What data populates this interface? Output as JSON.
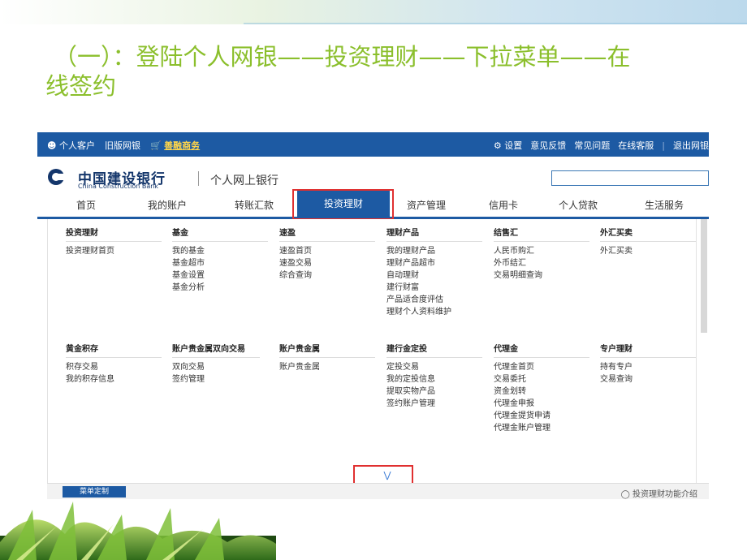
{
  "slide": {
    "title_line1": "（一）：登陆个人网银——投资理财——下拉菜单——在",
    "title_line2": "线签约"
  },
  "topbar": {
    "personal": "个人客户",
    "old_version": "旧版网银",
    "shanrong": "善融商务",
    "settings": "设置",
    "feedback": "意见反馈",
    "faq": "常见问题",
    "online_service": "在线客服",
    "logout": "退出网银"
  },
  "brand": {
    "name_cn": "中国建设银行",
    "name_en": "China Construction Bank",
    "product": "个人网上银行"
  },
  "search": {
    "placeholder": ""
  },
  "nav": {
    "items": [
      "首页",
      "我的账户",
      "转账汇款",
      "投资理财",
      "资产管理",
      "信用卡",
      "个人贷款",
      "生活服务"
    ],
    "active": "投资理财"
  },
  "menu": {
    "row1": [
      {
        "head": "投资理财",
        "links": [
          "投资理财首页"
        ]
      },
      {
        "head": "基金",
        "links": [
          "我的基金",
          "基金超市",
          "基金设置",
          "基金分析"
        ]
      },
      {
        "head": "速盈",
        "links": [
          "速盈首页",
          "速盈交易",
          "综合查询"
        ]
      },
      {
        "head": "理财产品",
        "links": [
          "我的理财产品",
          "理财产品超市",
          "自动理财",
          "建行财富",
          "产品适合度评估",
          "理财个人资料维护"
        ]
      },
      {
        "head": "结售汇",
        "links": [
          "人民币购汇",
          "外币结汇",
          "交易明细查询"
        ]
      },
      {
        "head": "外汇买卖",
        "links": [
          "外汇买卖"
        ]
      }
    ],
    "row2": [
      {
        "head": "黄金积存",
        "links": [
          "积存交易",
          "我的积存信息"
        ]
      },
      {
        "head": "账户贵金属双向交易",
        "links": [
          "双向交易",
          "签约管理"
        ]
      },
      {
        "head": "账户贵金属",
        "links": [
          "账户贵金属"
        ]
      },
      {
        "head": "建行金定投",
        "links": [
          "定投交易",
          "我的定投信息",
          "提取实物产品",
          "签约账户管理"
        ]
      },
      {
        "head": "代理金",
        "links": [
          "代理金首页",
          "交易委托",
          "资金划转",
          "代理金申报",
          "代理金提货申请",
          "代理金账户管理"
        ]
      },
      {
        "head": "专户理财",
        "links": [
          "持有专户",
          "交易查询"
        ]
      }
    ]
  },
  "footer": {
    "menu_custom": "菜单定制",
    "intro": "投资理财功能介绍"
  },
  "icons": {
    "person": "person-icon",
    "cart": "cart-icon",
    "gear": "gear-icon",
    "expand": "chevron-double-down-icon",
    "bulb": "lightbulb-icon"
  },
  "colors": {
    "title": "#8bbf2c",
    "nav_blue": "#1d5aa3",
    "highlight_red": "#e03030",
    "gold": "#ffd54a"
  }
}
